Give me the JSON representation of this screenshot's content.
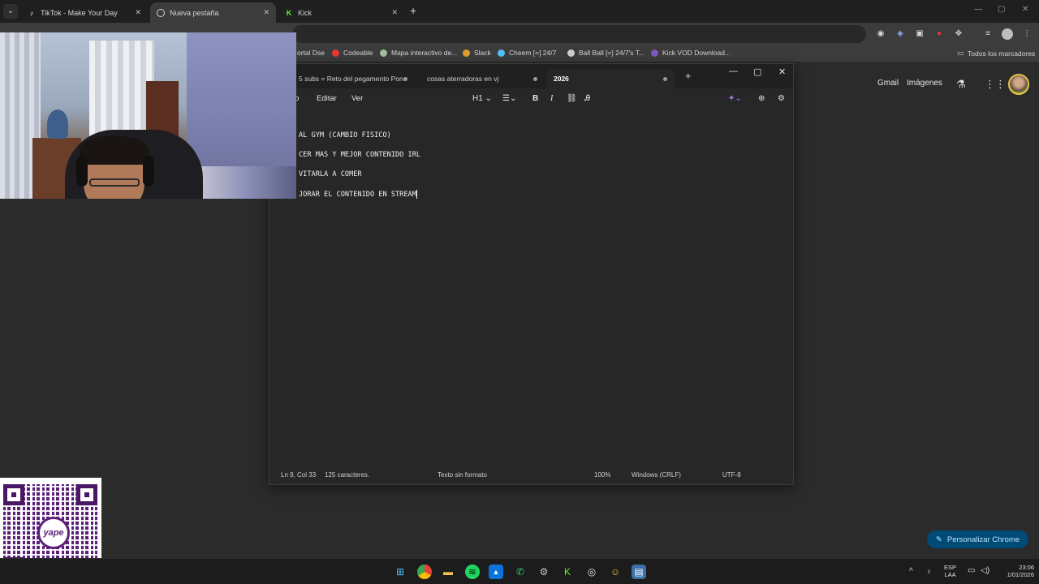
{
  "browser": {
    "tabs": [
      {
        "label": "TikTok - Make Your Day",
        "icon": "tiktok-icon",
        "active": false
      },
      {
        "label": "Nueva pestaña",
        "icon": "chrome-icon",
        "active": true
      },
      {
        "label": "Kick",
        "icon": "kick-icon",
        "active": false
      }
    ],
    "bookmarks": [
      {
        "label": "ortal Dse",
        "color": "#8ab4f8"
      },
      {
        "label": "Codeable",
        "color": "#e53935"
      },
      {
        "label": "Mapa interactivo de...",
        "color": "#a0c0a0"
      },
      {
        "label": "Slack",
        "color": "#e0a030"
      },
      {
        "label": "Cheem [=] 24/7",
        "color": "#4fc3f7"
      },
      {
        "label": "Ball Ball [=] 24/7's T...",
        "color": "#cfcfcf"
      },
      {
        "label": "Kick VOD Download...",
        "color": "#7e57c2"
      }
    ],
    "all_bookmarks": "Todos los marcadores"
  },
  "newtab_page": {
    "gmail": "Gmail",
    "images": "Imágenes",
    "customize_button": "Personalizar Chrome"
  },
  "notepad": {
    "tabs": [
      {
        "label": "5 subs = Reto del pegamento Pone",
        "active": false
      },
      {
        "label": "cosas aterradoras en vj",
        "active": false
      },
      {
        "label": "2026",
        "active": true
      }
    ],
    "menu": [
      "ro",
      "Editar",
      "Ver"
    ],
    "heading_select": "H1",
    "lines": [
      "AL GYM (CAMBIO FISICO)",
      "CER MAS Y MEJOR CONTENIDO IRL",
      "VITARLA A COMER",
      "JORAR EL CONTENIDO EN STREAM"
    ],
    "status": {
      "position": "Ln 9, Col 33",
      "chars": "125 caracteres.",
      "format": "Texto sin formato",
      "zoom": "100%",
      "line_ending": "Windows (CRLF)",
      "encoding": "UTF-8"
    }
  },
  "qr": {
    "logo_text": "yape"
  },
  "taskbar": {
    "lang_top": "ESP",
    "lang_bottom": "LAA",
    "time": "23:06",
    "date": "1/01/2026"
  }
}
